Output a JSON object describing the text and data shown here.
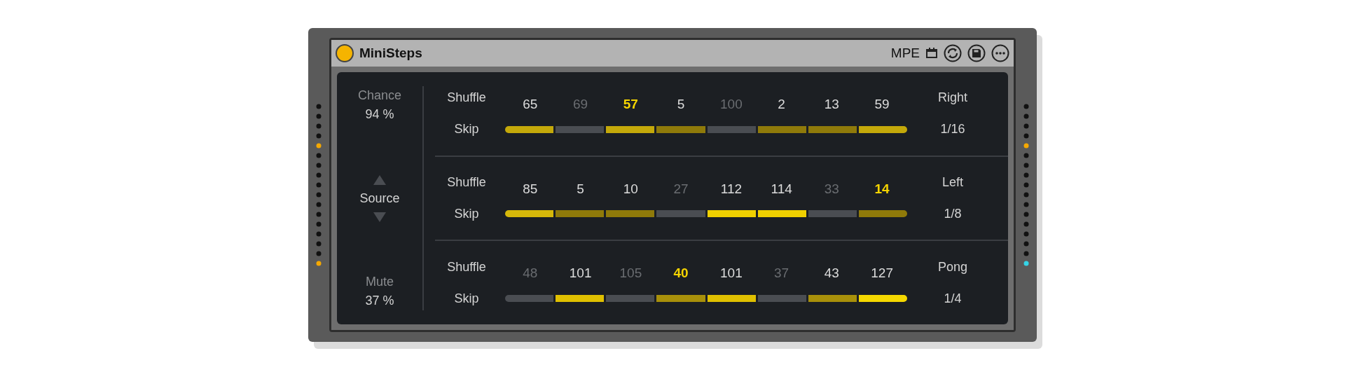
{
  "device": {
    "title": "MiniSteps",
    "on": true,
    "mpe_label": "MPE"
  },
  "left_panel": {
    "chance_label": "Chance",
    "chance_value": "94 %",
    "source_label": "Source",
    "mute_label": "Mute",
    "mute_value": "37 %"
  },
  "lanes": [
    {
      "shuffle_label": "Shuffle",
      "skip_label": "Skip",
      "direction": "Right",
      "rate": "1/16",
      "steps": [
        {
          "value": "65",
          "dim": false,
          "accent": false,
          "color": "#c4a90a"
        },
        {
          "value": "69",
          "dim": true,
          "accent": false,
          "color": "#4a4d52"
        },
        {
          "value": "57",
          "dim": false,
          "accent": true,
          "color": "#c4a90a"
        },
        {
          "value": "5",
          "dim": false,
          "accent": false,
          "color": "#8f7a0a"
        },
        {
          "value": "100",
          "dim": true,
          "accent": false,
          "color": "#4a4d52"
        },
        {
          "value": "2",
          "dim": false,
          "accent": false,
          "color": "#8f7a0a"
        },
        {
          "value": "13",
          "dim": false,
          "accent": false,
          "color": "#8f7a0a"
        },
        {
          "value": "59",
          "dim": false,
          "accent": false,
          "color": "#c4a90a"
        }
      ]
    },
    {
      "shuffle_label": "Shuffle",
      "skip_label": "Skip",
      "direction": "Left",
      "rate": "1/8",
      "steps": [
        {
          "value": "85",
          "dim": false,
          "accent": false,
          "color": "#d6b80a"
        },
        {
          "value": "5",
          "dim": false,
          "accent": false,
          "color": "#8f7a0a"
        },
        {
          "value": "10",
          "dim": false,
          "accent": false,
          "color": "#8f7a0a"
        },
        {
          "value": "27",
          "dim": true,
          "accent": false,
          "color": "#4a4d52"
        },
        {
          "value": "112",
          "dim": false,
          "accent": false,
          "color": "#f0d000"
        },
        {
          "value": "114",
          "dim": false,
          "accent": false,
          "color": "#f0d000"
        },
        {
          "value": "33",
          "dim": true,
          "accent": false,
          "color": "#4a4d52"
        },
        {
          "value": "14",
          "dim": false,
          "accent": true,
          "color": "#8f7a0a"
        }
      ]
    },
    {
      "shuffle_label": "Shuffle",
      "skip_label": "Skip",
      "direction": "Pong",
      "rate": "1/4",
      "steps": [
        {
          "value": "48",
          "dim": true,
          "accent": false,
          "color": "#4a4d52"
        },
        {
          "value": "101",
          "dim": false,
          "accent": false,
          "color": "#e0c000"
        },
        {
          "value": "105",
          "dim": true,
          "accent": false,
          "color": "#4a4d52"
        },
        {
          "value": "40",
          "dim": false,
          "accent": true,
          "color": "#a8900a"
        },
        {
          "value": "101",
          "dim": false,
          "accent": false,
          "color": "#e0c000"
        },
        {
          "value": "37",
          "dim": true,
          "accent": false,
          "color": "#4a4d52"
        },
        {
          "value": "43",
          "dim": false,
          "accent": false,
          "color": "#a8900a"
        },
        {
          "value": "127",
          "dim": false,
          "accent": false,
          "color": "#f5d800"
        }
      ]
    }
  ]
}
